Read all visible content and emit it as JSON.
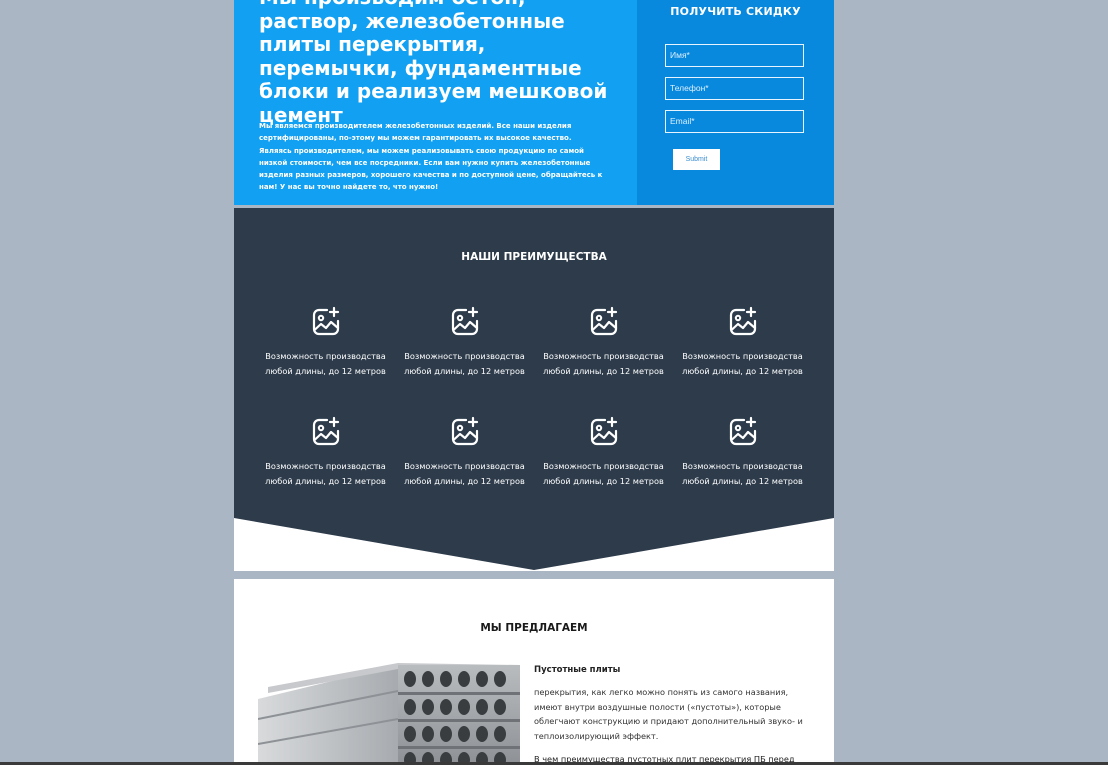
{
  "hero": {
    "title": "Мы производим бетон, раствор, железобетонные плиты перекрытия, перемычки, фундаментные блоки и реализуем мешковой цемент",
    "description": "Мы являемся производителем железобетонных изделий. Все наши изделия сертифицированы, по-этому мы можем гарантировать их высокое качество. Являясь производителем, мы можем реализовывать свою продукцию по самой низкой стоимости, чем все посредники. Если вам нужно купить железобетонные изделия разных размеров, хорошего качества и по доступной цене, обращайтесь к нам! У нас вы точно найдете то, что нужно!"
  },
  "form": {
    "title": "ПОЛУЧИТЬ СКИДКУ",
    "name_placeholder": "Имя*",
    "phone_placeholder": "Телефон*",
    "email_placeholder": "Email*",
    "submit_label": "Submit"
  },
  "advantages": {
    "title": "НАШИ ПРЕИМУЩЕСТВА",
    "items": [
      {
        "icon": "image-plus-icon",
        "text": "Возможность производства любой длины, до 12 метров"
      },
      {
        "icon": "image-plus-icon",
        "text": "Возможность производства любой длины, до 12 метров"
      },
      {
        "icon": "image-plus-icon",
        "text": "Возможность производства любой длины, до 12 метров"
      },
      {
        "icon": "image-plus-icon",
        "text": "Возможность производства любой длины, до 12 метров"
      },
      {
        "icon": "image-plus-icon",
        "text": "Возможность производства любой длины, до 12 метров"
      },
      {
        "icon": "image-plus-icon",
        "text": "Возможность производства любой длины, до 12 метров"
      },
      {
        "icon": "image-plus-icon",
        "text": "Возможность производства любой длины, до 12 метров"
      },
      {
        "icon": "image-plus-icon",
        "text": "Возможность производства любой длины, до 12 метров"
      }
    ]
  },
  "offer": {
    "title": "МЫ ПРЕДЛАГАЕМ",
    "product_title": "Пустотные плиты",
    "product_description": "перекрытия, как легко можно понять из самого названия, имеют внутри воздушные полости («пустоты»), которые облегчают конструкцию и придают дополнительный звуко- и теплоизолирующий эффект.",
    "product_more": "В чем преимущества пустотных плит перекрытия ПБ перед"
  },
  "colors": {
    "hero_bg": "#12a0f2",
    "form_bg": "#0989de",
    "advantages_bg": "#2d3b4b",
    "page_bg": "#aab6c3"
  }
}
